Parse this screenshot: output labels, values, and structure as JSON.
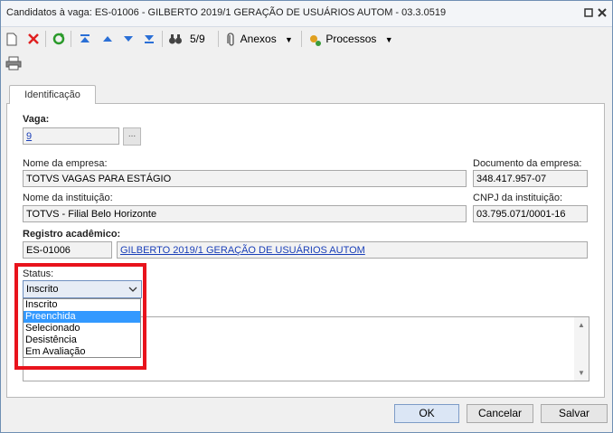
{
  "window": {
    "title": "Candidatos à vaga: ES-01006 - GILBERTO 2019/1 GERAÇÃO DE USUÁRIOS AUTOM - 03.3.0519"
  },
  "toolbar": {
    "record_position": "5/9",
    "attachments_label": "Anexos",
    "processes_label": "Processos"
  },
  "tabs": [
    {
      "label": "Identificação",
      "active": true
    }
  ],
  "form": {
    "vaga": {
      "label": "Vaga:",
      "value": "9"
    },
    "empresa": {
      "label": "Nome da empresa:",
      "value": "TOTVS VAGAS PARA ESTÁGIO"
    },
    "documento_empresa": {
      "label": "Documento da empresa:",
      "value": "348.417.957-07"
    },
    "instituicao": {
      "label": "Nome da instituição:",
      "value": "TOTVS - Filial Belo Horizonte"
    },
    "cnpj_instituicao": {
      "label": "CNPJ da instituição:",
      "value": "03.795.071/0001-16"
    },
    "registro": {
      "label": "Registro acadêmico:",
      "code": "ES-01006",
      "name": "GILBERTO 2019/1 GERAÇÃO DE USUÁRIOS AUTOM"
    },
    "status": {
      "label": "Status:",
      "selected": "Inscrito",
      "options": [
        "Inscrito",
        "Preenchida",
        "Selecionado",
        "Desistência",
        "Em Avaliação"
      ],
      "highlighted_index": 1
    }
  },
  "footer": {
    "ok_label": "OK",
    "cancel_label": "Cancelar",
    "save_label": "Salvar"
  },
  "colors": {
    "highlight": "#3399ff",
    "annotation_box": "#e8131c",
    "link": "#1a3fb8"
  }
}
